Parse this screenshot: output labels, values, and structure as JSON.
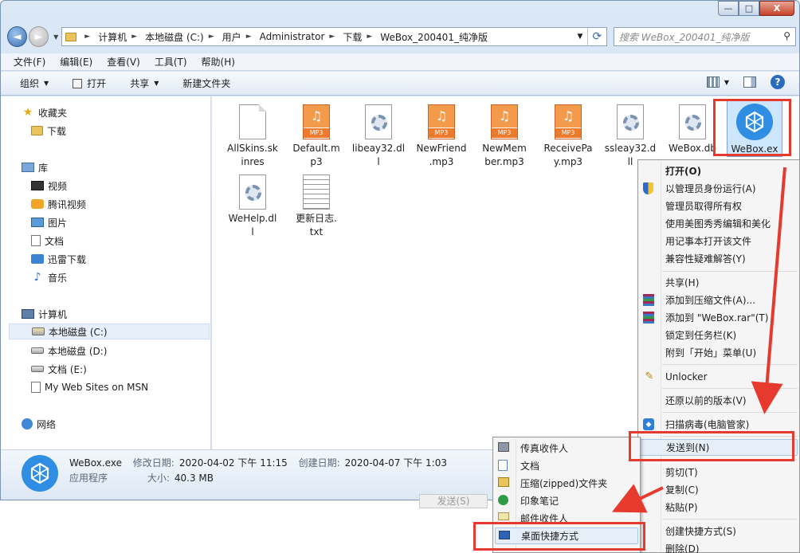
{
  "window": {
    "controls": {
      "minimize": "—",
      "maximize": "□",
      "close": "X"
    }
  },
  "nav": {
    "back": "◄",
    "forward": "►",
    "breadcrumb": [
      "计算机",
      "本地磁盘 (C:)",
      "用户",
      "Administrator",
      "下载",
      "WeBox_200401_纯净版"
    ],
    "search_placeholder": "搜索 WeBox_200401_纯净版"
  },
  "menubar": [
    "文件(F)",
    "编辑(E)",
    "查看(V)",
    "工具(T)",
    "帮助(H)"
  ],
  "toolbar": {
    "organize": "组织",
    "open": "打开",
    "share": "共享",
    "new_folder": "新建文件夹",
    "help": "?"
  },
  "sidebar": {
    "favorites": "收藏夹",
    "downloads": "下载",
    "libraries": "库",
    "lib_items": [
      "视频",
      "腾讯视频",
      "图片",
      "文档",
      "迅雷下载",
      "音乐"
    ],
    "computer": "计算机",
    "drives": [
      "本地磁盘 (C:)",
      "本地磁盘 (D:)",
      "文档 (E:)",
      "My Web Sites on MSN"
    ],
    "network": "网络"
  },
  "files": [
    {
      "name_l1": "AllSkins.sk",
      "name_l2": "inres",
      "type": "blank"
    },
    {
      "name_l1": "Default.m",
      "name_l2": "p3",
      "type": "mp3"
    },
    {
      "name_l1": "libeay32.dl",
      "name_l2": "l",
      "type": "dll"
    },
    {
      "name_l1": "NewFriend",
      "name_l2": ".mp3",
      "type": "mp3"
    },
    {
      "name_l1": "NewMem",
      "name_l2": "ber.mp3",
      "type": "mp3"
    },
    {
      "name_l1": "ReceivePa",
      "name_l2": "y.mp3",
      "type": "mp3"
    },
    {
      "name_l1": "ssleay32.d",
      "name_l2": "ll",
      "type": "dll"
    },
    {
      "name_l1": "WeBox.db",
      "name_l2": "",
      "type": "dll"
    },
    {
      "name_l1": "WeBox.ex",
      "name_l2": "",
      "type": "exe"
    },
    {
      "name_l1": "WeHelp.dl",
      "name_l2": "l",
      "type": "dll"
    },
    {
      "name_l1": "更新日志.",
      "name_l2": "txt",
      "type": "txt"
    }
  ],
  "mp3_badge": "MP3",
  "details": {
    "name": "WeBox.exe",
    "modified_label": "修改日期:",
    "modified": "2020-04-02 下午 11:15",
    "created_label": "创建日期:",
    "created": "2020-04-07 下午 1:03",
    "type": "应用程序",
    "size_label": "大小:",
    "size": "40.3 MB"
  },
  "ghost_button": "发送(S)",
  "context_menu": [
    {
      "label": "打开(O)"
    },
    {
      "label": "以管理员身份运行(A)"
    },
    {
      "label": "管理员取得所有权"
    },
    {
      "label": "使用美图秀秀编辑和美化"
    },
    {
      "label": "用记事本打开该文件"
    },
    {
      "label": "兼容性疑难解答(Y)"
    },
    {
      "label": "共享(H)"
    },
    {
      "label": "添加到压缩文件(A)..."
    },
    {
      "label": "添加到 \"WeBox.rar\"(T)"
    },
    {
      "label": "锁定到任务栏(K)"
    },
    {
      "label": "附到「开始」菜单(U)"
    },
    {
      "label": "Unlocker"
    },
    {
      "label": "还原以前的版本(V)"
    },
    {
      "label": "扫描病毒(电脑管家)"
    },
    {
      "label": "发送到(N)"
    },
    {
      "label": "剪切(T)"
    },
    {
      "label": "复制(C)"
    },
    {
      "label": "粘贴(P)"
    },
    {
      "label": "创建快捷方式(S)"
    },
    {
      "label": "删除(D)"
    }
  ],
  "sendto_menu": [
    {
      "label": "传真收件人"
    },
    {
      "label": "文档"
    },
    {
      "label": "压缩(zipped)文件夹"
    },
    {
      "label": "印象笔记"
    },
    {
      "label": "邮件收件人"
    },
    {
      "label": "桌面快捷方式"
    }
  ],
  "colors": {
    "annotation_red": "#e63a2e",
    "webox_blue": "#2f8ee3",
    "selection": "#cde6fb"
  }
}
